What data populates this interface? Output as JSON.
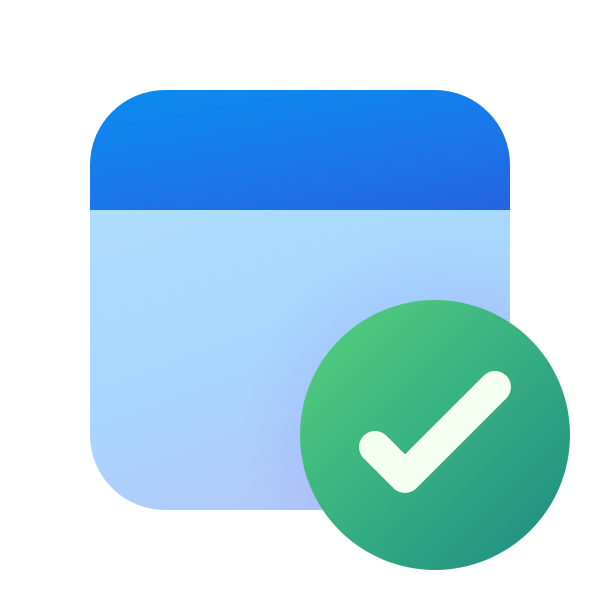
{
  "icon": {
    "name": "application-window-check-icon",
    "colors": {
      "title_bar_start": "#0a8cf0",
      "title_bar_end": "#2563e3",
      "window_body": "#a7d7fe",
      "window_body_bottom": "#b8c2f6",
      "badge_start": "#4fd07d",
      "badge_end": "#1a8a82",
      "checkmark": "#f4fff2"
    }
  }
}
